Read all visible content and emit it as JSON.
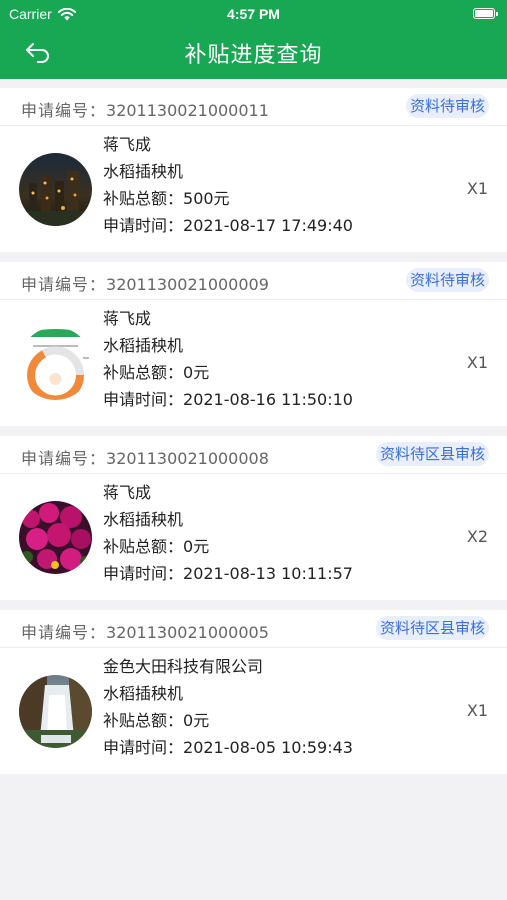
{
  "status_bar": {
    "carrier": "Carrier",
    "time": "4:57 PM"
  },
  "nav": {
    "title": "补贴进度查询"
  },
  "labels": {
    "app_no": "申请编号：",
    "subsidy": "补贴总额：",
    "apply_time": "申请时间："
  },
  "applications": [
    {
      "app_no": "3201130021000011",
      "status": "资料待审核",
      "applicant": "蒋飞成",
      "machine": "水稻插秧机",
      "amount": "500元",
      "time": "2021-08-17 17:49:40",
      "qty": "X1",
      "thumb": "night-city-thumbnail"
    },
    {
      "app_no": "3201130021000009",
      "status": "资料待审核",
      "applicant": "蒋飞成",
      "machine": "水稻插秧机",
      "amount": "0元",
      "time": "2021-08-16 11:50:10",
      "qty": "X1",
      "thumb": "gauge-screenshot-thumbnail"
    },
    {
      "app_no": "3201130021000008",
      "status": "资料待区县审核",
      "applicant": "蒋飞成",
      "machine": "水稻插秧机",
      "amount": "0元",
      "time": "2021-08-13 10:11:57",
      "qty": "X2",
      "thumb": "flower-field-thumbnail"
    },
    {
      "app_no": "3201130021000005",
      "status": "资料待区县审核",
      "applicant": "金色大田科技有限公司",
      "machine": "水稻插秧机",
      "amount": "0元",
      "time": "2021-08-05 10:59:43",
      "qty": "X1",
      "thumb": "waterfall-thumbnail"
    }
  ]
}
